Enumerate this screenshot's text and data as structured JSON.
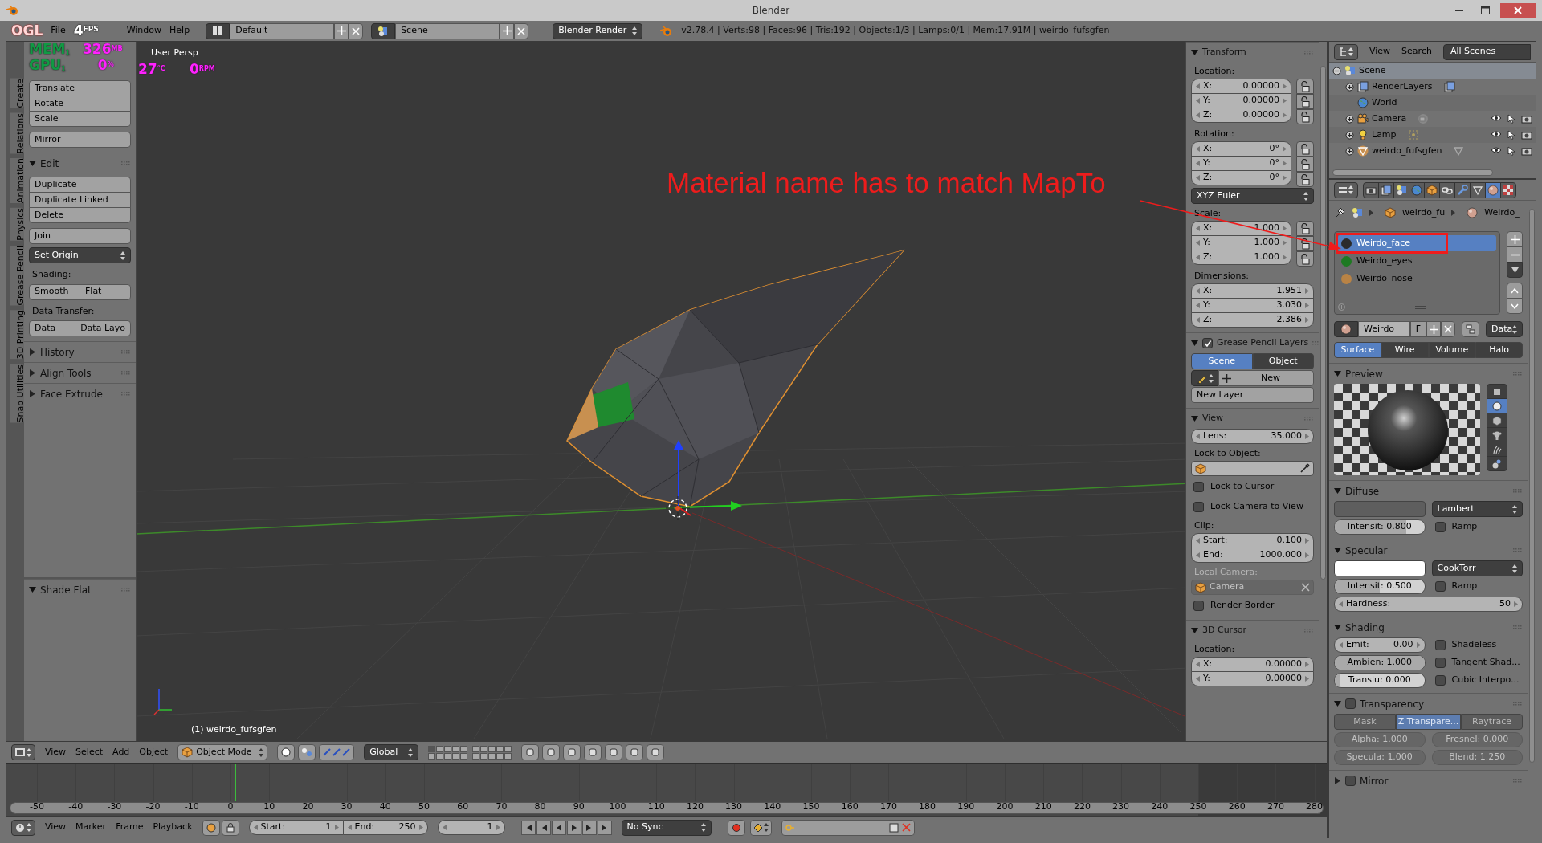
{
  "window": {
    "title": "Blender"
  },
  "overlay": {
    "ogl": "OGL",
    "fps": "4",
    "fps_unit": "FPS",
    "mem_label": "MEM",
    "mem_index": "1",
    "mem": "326",
    "mem_unit": "MB",
    "gpu_label": "GPU",
    "gpu_index": "1",
    "gpu": "0",
    "gpu_unit": "%",
    "temp": "27",
    "temp_unit": "°C",
    "fan": "0",
    "fan_unit": "RPM"
  },
  "info_header": {
    "menus": [
      "File",
      "Window",
      "Help"
    ],
    "layout": "Default",
    "scene": "Scene",
    "engine": "Blender Render",
    "stats": "v2.78.4 | Verts:98 | Faces:96 | Tris:192 | Objects:1/3 | Lamps:0/1 | Mem:17.91M | weirdo_fufsgfen"
  },
  "tool_shelf": {
    "tabs": [
      "Create",
      "Relations",
      "Animation",
      "Physics",
      "Grease Pencil",
      "3D Printing",
      "Snap Utilities"
    ],
    "transform_buttons": [
      "Translate",
      "Rotate",
      "Scale"
    ],
    "mirror": "Mirror",
    "edit": {
      "title": "Edit",
      "expanded": true,
      "buttons": [
        "Duplicate",
        "Duplicate Linked",
        "Delete"
      ],
      "join": "Join",
      "set_origin": "Set Origin",
      "shading_label": "Shading:",
      "shading_buttons": [
        "Smooth",
        "Flat"
      ],
      "transfer_label": "Data Transfer:",
      "transfer_buttons": [
        "Data",
        "Data Layo"
      ]
    },
    "panels": [
      {
        "title": "History",
        "expanded": false
      },
      {
        "title": "Align Tools",
        "expanded": false
      },
      {
        "title": "Face Extrude",
        "expanded": false
      }
    ],
    "operator_panel": {
      "title": "Shade Flat",
      "expanded": true
    }
  },
  "viewport": {
    "view_name": "User Persp",
    "object_label": "(1) weirdo_fufsgfen",
    "annotation": "Material name has to match MapTo"
  },
  "n_panel": {
    "sections": [
      {
        "title": "Transform",
        "expanded": true,
        "items": [
          {
            "kind": "label",
            "text": "Location:"
          },
          {
            "kind": "locked_fields",
            "rows": [
              {
                "label": "X:",
                "value": "0.00000"
              },
              {
                "label": "Y:",
                "value": "0.00000"
              },
              {
                "label": "Z:",
                "value": "0.00000"
              }
            ]
          },
          {
            "kind": "label",
            "text": "Rotation:"
          },
          {
            "kind": "locked_fields",
            "rows": [
              {
                "label": "X:",
                "value": "0°"
              },
              {
                "label": "Y:",
                "value": "0°"
              },
              {
                "label": "Z:",
                "value": "0°"
              }
            ]
          },
          {
            "kind": "dropdown",
            "text": "XYZ Euler"
          },
          {
            "kind": "label",
            "text": "Scale:"
          },
          {
            "kind": "locked_fields",
            "rows": [
              {
                "label": "X:",
                "value": "1.000"
              },
              {
                "label": "Y:",
                "value": "1.000"
              },
              {
                "label": "Z:",
                "value": "1.000"
              }
            ]
          },
          {
            "kind": "label",
            "text": "Dimensions:"
          },
          {
            "kind": "fields",
            "rows": [
              {
                "label": "X:",
                "value": "1.951"
              },
              {
                "label": "Y:",
                "value": "3.030"
              },
              {
                "label": "Z:",
                "value": "2.386"
              }
            ]
          }
        ]
      },
      {
        "title": "Grease Pencil Layers",
        "expanded": true,
        "enabled": true,
        "items": [
          {
            "kind": "segmented",
            "options": [
              {
                "label": "Scene",
                "selected": true
              },
              {
                "label": "Object",
                "selected": false
              }
            ]
          },
          {
            "kind": "new_row",
            "text": "New"
          },
          {
            "kind": "button",
            "text": "New Layer"
          }
        ]
      },
      {
        "title": "View",
        "expanded": true,
        "items": [
          {
            "kind": "fields",
            "rows": [
              {
                "label": "Lens:",
                "value": "35.000"
              }
            ]
          },
          {
            "kind": "label",
            "text": "Lock to Object:"
          },
          {
            "kind": "object_picker"
          },
          {
            "kind": "checkbox",
            "text": "Lock to Cursor",
            "checked": false
          },
          {
            "kind": "checkbox",
            "text": "Lock Camera to View",
            "checked": false
          },
          {
            "kind": "label",
            "text": "Clip:"
          },
          {
            "kind": "fields",
            "rows": [
              {
                "label": "Start:",
                "value": "0.100"
              },
              {
                "label": "End:",
                "value": "1000.000"
              }
            ]
          },
          {
            "kind": "dim_label",
            "text": "Local Camera:"
          },
          {
            "kind": "dim_object_field",
            "text": "Camera"
          },
          {
            "kind": "checkbox",
            "text": "Render Border",
            "checked": false
          }
        ]
      },
      {
        "title": "3D Cursor",
        "expanded": true,
        "items": [
          {
            "kind": "label",
            "text": "Location:"
          },
          {
            "kind": "fields",
            "rows": [
              {
                "label": "X:",
                "value": "0.00000"
              },
              {
                "label": "Y:",
                "value": "0.00000"
              }
            ]
          }
        ]
      }
    ]
  },
  "view_header": {
    "menus": [
      "View",
      "Select",
      "Add",
      "Object"
    ],
    "mode": "Object Mode",
    "orientation": "Global"
  },
  "timeline": {
    "ticks": [
      "-50",
      "-40",
      "-30",
      "-20",
      "-10",
      "0",
      "10",
      "20",
      "30",
      "40",
      "50",
      "60",
      "70",
      "80",
      "90",
      "100",
      "110",
      "120",
      "130",
      "140",
      "150",
      "160",
      "170",
      "180",
      "190",
      "200",
      "210",
      "220",
      "230",
      "240",
      "250",
      "260",
      "270",
      "280"
    ]
  },
  "timeline_header": {
    "menus": [
      "View",
      "Marker",
      "Frame",
      "Playback"
    ],
    "start": {
      "label": "Start:",
      "value": "1"
    },
    "end": {
      "label": "End:",
      "value": "250"
    },
    "frame": "1",
    "sync": "No Sync"
  },
  "outliner": {
    "menus": [
      "View",
      "Search"
    ],
    "filter": "All Scenes",
    "tree": [
      {
        "label": "Scene",
        "kind": "scene",
        "selected": true,
        "expanded": true,
        "children": [
          {
            "label": "RenderLayers",
            "kind": "renderlayers",
            "selected": false,
            "expanded": false
          },
          {
            "label": "World",
            "kind": "world",
            "selected": false
          },
          {
            "label": "Camera",
            "kind": "camera",
            "selected": false,
            "expanded": false
          },
          {
            "label": "Lamp",
            "kind": "lamp",
            "selected": false,
            "expanded": false
          },
          {
            "label": "weirdo_fufsgfen",
            "kind": "mesh",
            "selected": false,
            "expanded": false
          }
        ]
      }
    ]
  },
  "properties": {
    "tabs": [
      {
        "kind": "render",
        "selected": false
      },
      {
        "kind": "render_layers",
        "selected": false
      },
      {
        "kind": "scene",
        "selected": false
      },
      {
        "kind": "world",
        "selected": false
      },
      {
        "kind": "object",
        "selected": false
      },
      {
        "kind": "constraints",
        "selected": false
      },
      {
        "kind": "modifiers",
        "selected": false
      },
      {
        "kind": "data",
        "selected": false
      },
      {
        "kind": "material",
        "selected": true
      },
      {
        "kind": "texture",
        "selected": false
      }
    ],
    "breadcrumb": [
      "weirdo_fu",
      "Weirdo_"
    ],
    "slots": [
      {
        "name": "Weirdo_face",
        "color": "#2b2b2b",
        "selected": true
      },
      {
        "name": "Weirdo_eyes",
        "color": "#1e7a22",
        "selected": false
      },
      {
        "name": "Weirdo_nose",
        "color": "#b98345",
        "selected": false
      }
    ],
    "material_id": {
      "name": "Weirdo",
      "fake": "F",
      "link": "Data"
    },
    "shader_tabs": [
      {
        "label": "Surface",
        "selected": true
      },
      {
        "label": "Wire",
        "selected": false
      },
      {
        "label": "Volume",
        "selected": false
      },
      {
        "label": "Halo",
        "selected": false
      }
    ],
    "sections": [
      {
        "title": "Preview",
        "expanded": true,
        "items": [
          {
            "kind": "preview",
            "types": [
              {
                "kind": "flat",
                "selected": false
              },
              {
                "kind": "sphere",
                "selected": true
              },
              {
                "kind": "cube",
                "selected": false
              },
              {
                "kind": "monkey",
                "selected": false
              },
              {
                "kind": "hair",
                "selected": false
              },
              {
                "kind": "sky",
                "selected": false
              }
            ]
          }
        ]
      },
      {
        "title": "Diffuse",
        "expanded": true,
        "items": [
          {
            "kind": "swatch_dropdown",
            "color": "#5e5e5e",
            "text": "Lambert"
          },
          {
            "kind": "slider_check",
            "label": "Intensit:",
            "value": "0.800",
            "level": 0.8,
            "check_label": "Ramp",
            "checked": false
          }
        ]
      },
      {
        "title": "Specular",
        "expanded": true,
        "items": [
          {
            "kind": "swatch_dropdown",
            "color": "#ffffff",
            "text": "CookTorr"
          },
          {
            "kind": "slider_check",
            "label": "Intensit:",
            "value": "0.500",
            "level": 0.5,
            "check_label": "Ramp",
            "checked": false
          },
          {
            "kind": "number",
            "label": "Hardness:",
            "value": "50"
          }
        ]
      },
      {
        "title": "Shading",
        "expanded": true,
        "items": [
          {
            "kind": "field_check",
            "label": "Emit:",
            "value": "0.00",
            "check_label": "Shadeless",
            "checked": false
          },
          {
            "kind": "slider_check",
            "label": "Ambien:",
            "value": "1.000",
            "level": 1,
            "check_label": "Tangent Shad...",
            "checked": false
          },
          {
            "kind": "slider_check",
            "label": "Translu:",
            "value": "0.000",
            "level": 0,
            "check_label": "Cubic Interpo...",
            "checked": false
          }
        ]
      },
      {
        "title": "Transparency",
        "expanded": true,
        "enabled": false,
        "items": [
          {
            "kind": "dim_segmented",
            "options": [
              {
                "label": "Mask",
                "selected": false
              },
              {
                "label": "Z Transpare...",
                "selected": true
              },
              {
                "label": "Raytrace",
                "selected": false
              }
            ]
          },
          {
            "kind": "dim_pair",
            "fields": [
              {
                "label": "Alpha:",
                "value": "1.000"
              },
              {
                "label": "Fresnel:",
                "value": "0.000"
              }
            ]
          },
          {
            "kind": "dim_pair",
            "fields": [
              {
                "label": "Specula:",
                "value": "1.000"
              },
              {
                "label": "Blend:",
                "value": "1.250"
              }
            ]
          }
        ]
      },
      {
        "title": "Mirror",
        "expanded": false,
        "enabled": false
      }
    ]
  }
}
